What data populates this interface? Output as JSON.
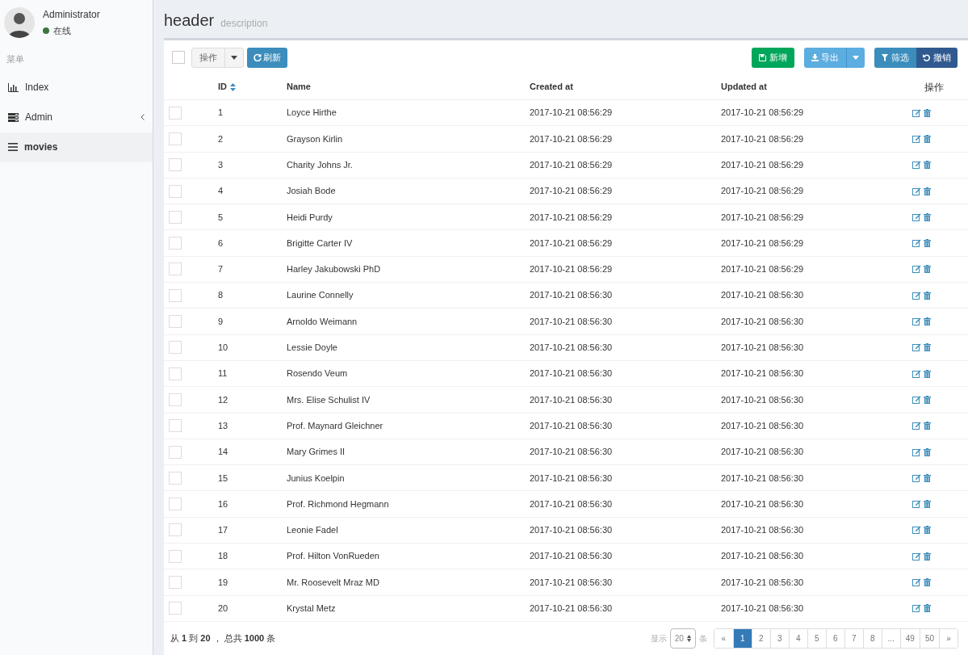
{
  "user": {
    "name": "Administrator",
    "status": "在线",
    "online": true
  },
  "sidebar": {
    "menu_label": "菜单",
    "items": [
      {
        "label": "Index",
        "kind": "chart",
        "selected": false,
        "expandable": false
      },
      {
        "label": "Admin",
        "kind": "server",
        "selected": false,
        "expandable": true
      },
      {
        "label": "movies",
        "kind": "bars",
        "selected": true,
        "expandable": false
      }
    ]
  },
  "header": {
    "title": "header",
    "description": "description"
  },
  "toolbar": {
    "select_all": {
      "checked": false
    },
    "actions_label": "操作",
    "refresh_label": "刷新",
    "new_label": "新增",
    "export_label": "导出",
    "filter_label": "筛选",
    "reset_label": "撤销"
  },
  "table": {
    "columns": [
      "ID",
      "Name",
      "Created at",
      "Updated at",
      "操作"
    ],
    "rows": [
      {
        "id": "1",
        "name": "Loyce Hirthe",
        "created_at": "2017-10-21 08:56:29",
        "updated_at": "2017-10-21 08:56:29",
        "checked": false
      },
      {
        "id": "2",
        "name": "Grayson Kirlin",
        "created_at": "2017-10-21 08:56:29",
        "updated_at": "2017-10-21 08:56:29",
        "checked": false
      },
      {
        "id": "3",
        "name": "Charity Johns Jr.",
        "created_at": "2017-10-21 08:56:29",
        "updated_at": "2017-10-21 08:56:29",
        "checked": false
      },
      {
        "id": "4",
        "name": "Josiah Bode",
        "created_at": "2017-10-21 08:56:29",
        "updated_at": "2017-10-21 08:56:29",
        "checked": false
      },
      {
        "id": "5",
        "name": "Heidi Purdy",
        "created_at": "2017-10-21 08:56:29",
        "updated_at": "2017-10-21 08:56:29",
        "checked": false
      },
      {
        "id": "6",
        "name": "Brigitte Carter IV",
        "created_at": "2017-10-21 08:56:29",
        "updated_at": "2017-10-21 08:56:29",
        "checked": false
      },
      {
        "id": "7",
        "name": "Harley Jakubowski PhD",
        "created_at": "2017-10-21 08:56:29",
        "updated_at": "2017-10-21 08:56:29",
        "checked": false
      },
      {
        "id": "8",
        "name": "Laurine Connelly",
        "created_at": "2017-10-21 08:56:30",
        "updated_at": "2017-10-21 08:56:30",
        "checked": false
      },
      {
        "id": "9",
        "name": "Arnoldo Weimann",
        "created_at": "2017-10-21 08:56:30",
        "updated_at": "2017-10-21 08:56:30",
        "checked": false
      },
      {
        "id": "10",
        "name": "Lessie Doyle",
        "created_at": "2017-10-21 08:56:30",
        "updated_at": "2017-10-21 08:56:30",
        "checked": false
      },
      {
        "id": "11",
        "name": "Rosendo Veum",
        "created_at": "2017-10-21 08:56:30",
        "updated_at": "2017-10-21 08:56:30",
        "checked": false
      },
      {
        "id": "12",
        "name": "Mrs. Elise Schulist IV",
        "created_at": "2017-10-21 08:56:30",
        "updated_at": "2017-10-21 08:56:30",
        "checked": false
      },
      {
        "id": "13",
        "name": "Prof. Maynard Gleichner",
        "created_at": "2017-10-21 08:56:30",
        "updated_at": "2017-10-21 08:56:30",
        "checked": false
      },
      {
        "id": "14",
        "name": "Mary Grimes II",
        "created_at": "2017-10-21 08:56:30",
        "updated_at": "2017-10-21 08:56:30",
        "checked": false
      },
      {
        "id": "15",
        "name": "Junius Koelpin",
        "created_at": "2017-10-21 08:56:30",
        "updated_at": "2017-10-21 08:56:30",
        "checked": false
      },
      {
        "id": "16",
        "name": "Prof. Richmond Hegmann",
        "created_at": "2017-10-21 08:56:30",
        "updated_at": "2017-10-21 08:56:30",
        "checked": false
      },
      {
        "id": "17",
        "name": "Leonie Fadel",
        "created_at": "2017-10-21 08:56:30",
        "updated_at": "2017-10-21 08:56:30",
        "checked": false
      },
      {
        "id": "18",
        "name": "Prof. Hilton VonRueden",
        "created_at": "2017-10-21 08:56:30",
        "updated_at": "2017-10-21 08:56:30",
        "checked": false
      },
      {
        "id": "19",
        "name": "Mr. Roosevelt Mraz MD",
        "created_at": "2017-10-21 08:56:30",
        "updated_at": "2017-10-21 08:56:30",
        "checked": false
      },
      {
        "id": "20",
        "name": "Krystal Metz",
        "created_at": "2017-10-21 08:56:30",
        "updated_at": "2017-10-21 08:56:30",
        "checked": false
      }
    ]
  },
  "footer": {
    "summary": "从 **1** 到 **20** ， 总共 **1000** 条",
    "show_label": "显示",
    "page_size": "20",
    "per_label": "条",
    "pages": [
      {
        "label": "«",
        "selected": false
      },
      {
        "label": "1",
        "selected": true
      },
      {
        "label": "2",
        "selected": false
      },
      {
        "label": "3",
        "selected": false
      },
      {
        "label": "4",
        "selected": false
      },
      {
        "label": "5",
        "selected": false
      },
      {
        "label": "6",
        "selected": false
      },
      {
        "label": "7",
        "selected": false
      },
      {
        "label": "8",
        "selected": false
      },
      {
        "label": "...",
        "selected": false
      },
      {
        "label": "49",
        "selected": false
      },
      {
        "label": "50",
        "selected": false
      },
      {
        "label": "»",
        "selected": false
      }
    ]
  }
}
